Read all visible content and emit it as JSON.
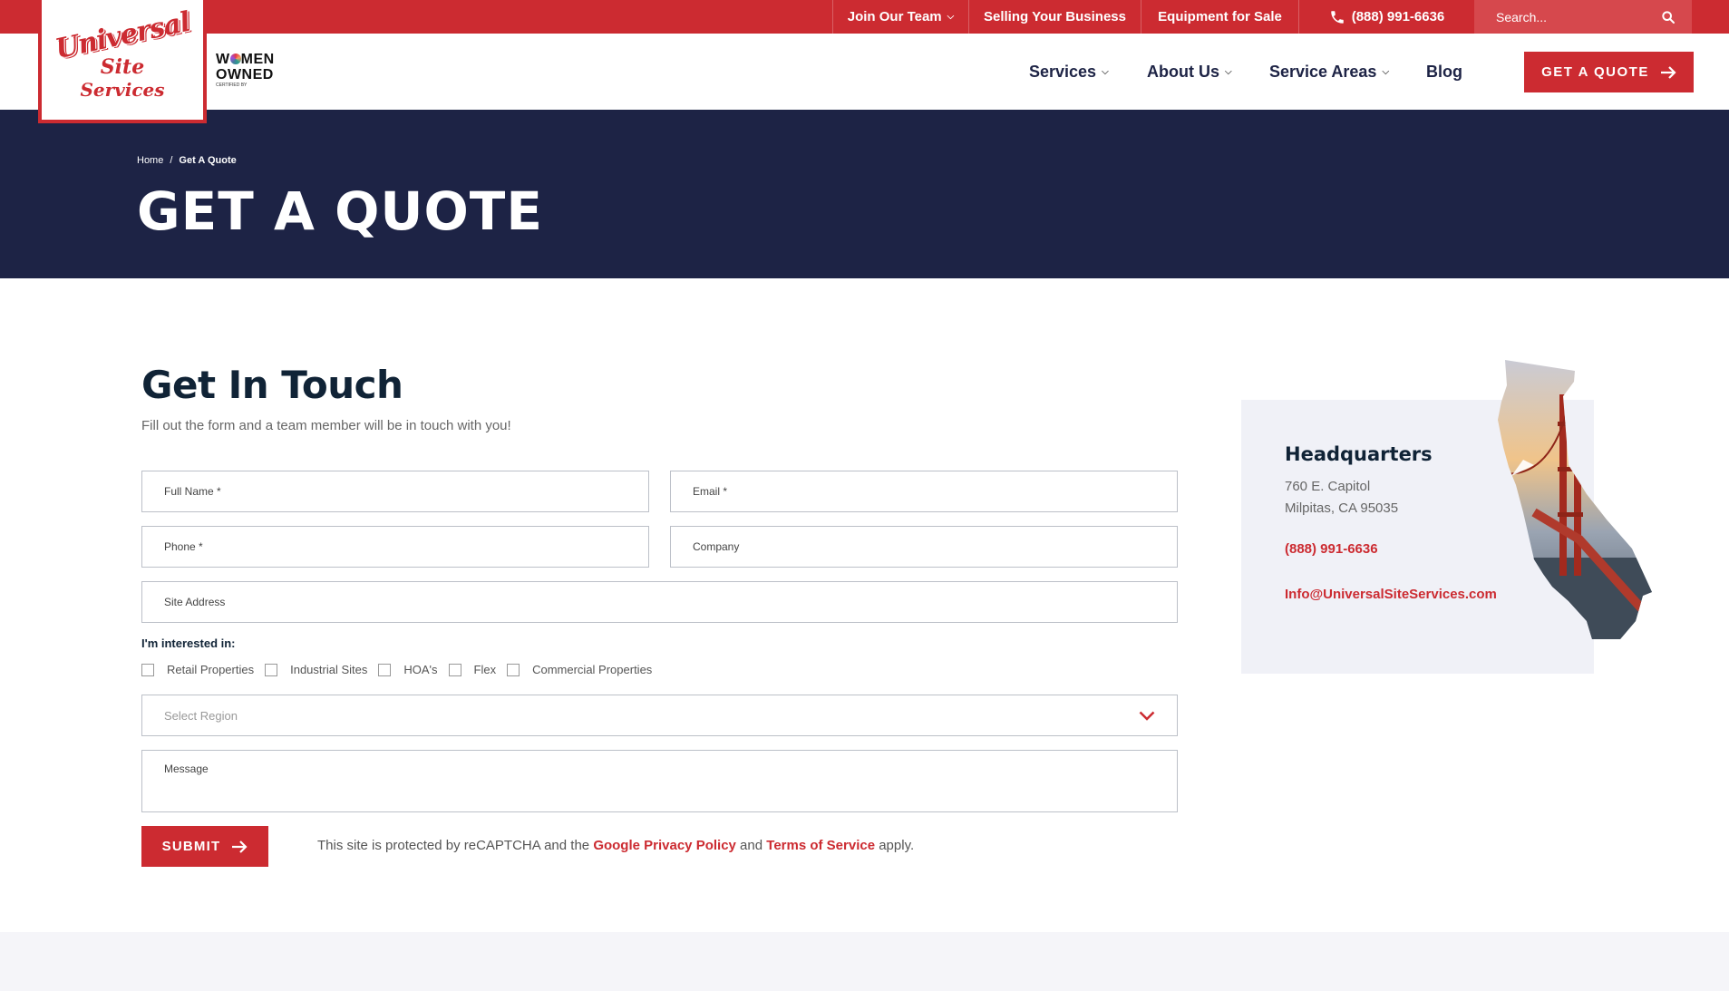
{
  "topbar": {
    "join_team": "Join Our Team",
    "selling_business": "Selling Your Business",
    "equipment": "Equipment for Sale",
    "phone": "(888) 991-6636",
    "search_placeholder": "Search..."
  },
  "logo": {
    "line1": "Universal",
    "line2": "Site",
    "line3": "Services"
  },
  "badge": {
    "line1a": "W",
    "line1b": "MEN",
    "line2": "OWNED",
    "fine": "CERTIFIED BY"
  },
  "nav": {
    "services": "Services",
    "about": "About Us",
    "areas": "Service Areas",
    "blog": "Blog",
    "quote_button": "GET A QUOTE"
  },
  "hero": {
    "breadcrumb_home": "Home",
    "breadcrumb_sep": "/",
    "breadcrumb_current": "Get A Quote",
    "title": "GET A QUOTE"
  },
  "form": {
    "heading": "Get In Touch",
    "subtitle": "Fill out the form and a team member will be in touch with you!",
    "full_name_placeholder": "Full Name *",
    "email_placeholder": "Email *",
    "phone_placeholder": "Phone *",
    "company_placeholder": "Company",
    "site_address_placeholder": "Site Address",
    "interest_label": "I'm interested in:",
    "interests": [
      "Retail Properties",
      "Industrial Sites",
      "HOA's",
      "Flex",
      "Commercial Properties"
    ],
    "region_placeholder": "Select Region",
    "message_placeholder": "Message",
    "submit": "SUBMIT",
    "recaptcha_pre": "This site is protected by reCAPTCHA and the ",
    "privacy_link": "Google Privacy Policy",
    "recaptcha_and": " and ",
    "terms_link": "Terms of Service",
    "recaptcha_post": " apply."
  },
  "hq": {
    "title": "Headquarters",
    "address1": "760 E. Capitol",
    "address2": "Milpitas, CA 95035",
    "phone": "(888) 991-6636",
    "email": "Info@UniversalSiteServices.com"
  },
  "colors": {
    "brand_red": "#cc2b31",
    "navy": "#1d2345",
    "card_bg": "#f0f1f7"
  }
}
